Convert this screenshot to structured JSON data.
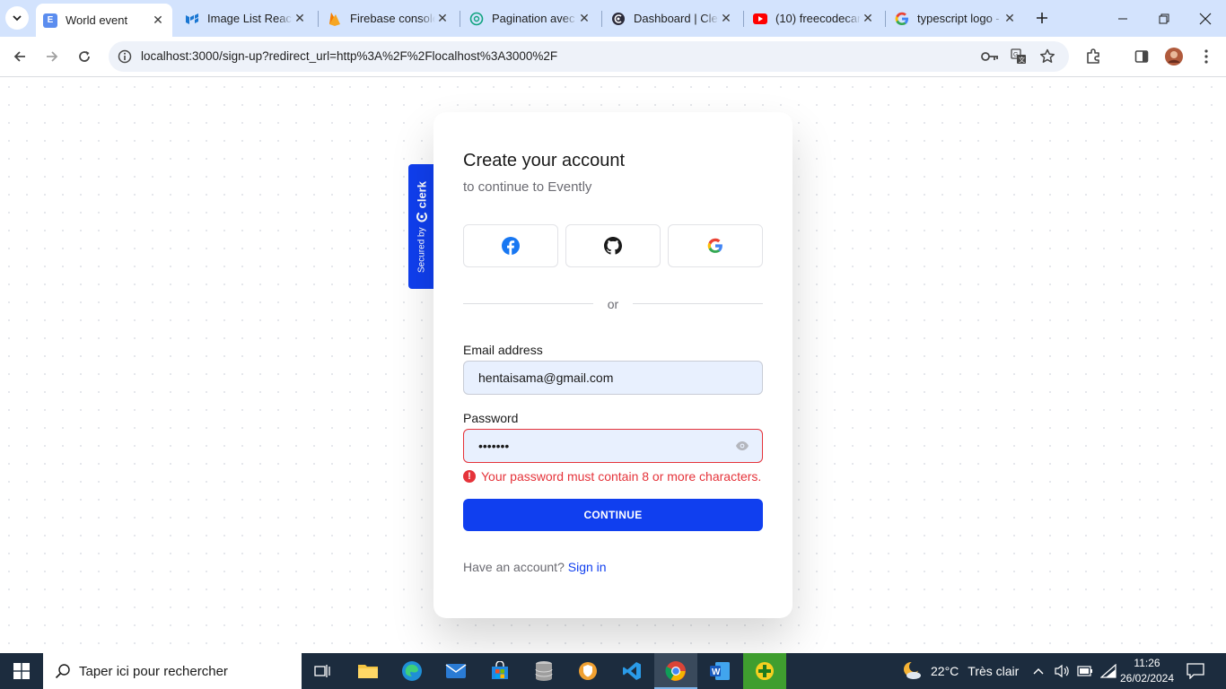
{
  "browser": {
    "tabs": [
      {
        "title": "World event",
        "icon": "evently-favicon",
        "active": true
      },
      {
        "title": "Image List React",
        "icon": "mui-favicon",
        "active": false
      },
      {
        "title": "Firebase console",
        "icon": "firebase-favicon",
        "active": false
      },
      {
        "title": "Pagination avec",
        "icon": "chatgpt-favicon",
        "active": false
      },
      {
        "title": "Dashboard | Cler",
        "icon": "clerk-favicon",
        "active": false
      },
      {
        "title": "(10) freecodecan",
        "icon": "youtube-favicon",
        "active": false
      },
      {
        "title": "typescript logo -",
        "icon": "google-favicon",
        "active": false
      }
    ],
    "url": "localhost:3000/sign-up?redirect_url=http%3A%2F%2Flocalhost%3A3000%2F"
  },
  "clerk_badge": {
    "secured": "Secured by",
    "brand": "clerk"
  },
  "signup": {
    "title": "Create your account",
    "subtitle": "to continue to Evently",
    "social": [
      "facebook-icon",
      "github-icon",
      "google-icon"
    ],
    "divider": "or",
    "email_label": "Email address",
    "email_value": "hentaisama@gmail.com",
    "password_label": "Password",
    "password_value": "•••••••",
    "password_error": "Your password must contain 8 or more characters.",
    "continue_label": "CONTINUE",
    "footer_text": "Have an account?",
    "footer_link": "Sign in"
  },
  "taskbar": {
    "search_placeholder": "Taper ici pour rechercher",
    "weather_temp": "22°C",
    "weather_desc": "Très clair",
    "time": "11:26",
    "date": "26/02/2024"
  },
  "colors": {
    "brand": "#103fef",
    "error": "#e5333a",
    "tab_strip": "#d3e3fd",
    "taskbar": "#1c2c3e"
  }
}
